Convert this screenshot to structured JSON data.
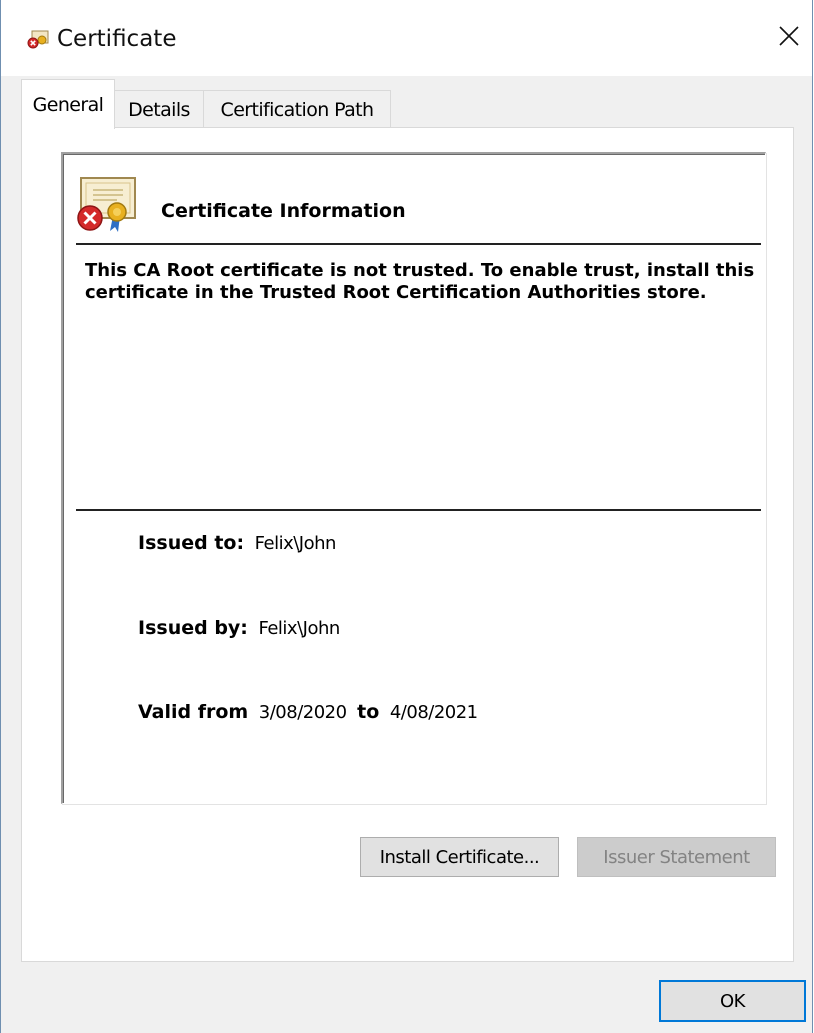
{
  "window": {
    "title": "Certificate",
    "title_icon": "certificate-error-icon",
    "close_icon": "close-icon"
  },
  "tabs": [
    {
      "label": "General",
      "active": true
    },
    {
      "label": "Details",
      "active": false
    },
    {
      "label": "Certification Path",
      "active": false
    }
  ],
  "general": {
    "icon": "certificate-error-icon",
    "heading": "Certificate Information",
    "message": "This CA Root certificate is not trusted. To enable trust, install this certificate in the Trusted Root Certification Authorities store.",
    "issued_to_label": "Issued to:",
    "issued_to_value": "Felix\\John",
    "issued_by_label": "Issued by:",
    "issued_by_value": "Felix\\John",
    "valid_from_label": "Valid from",
    "valid_from_value": "3/08/2020",
    "valid_to_label": "to",
    "valid_to_value": "4/08/2021"
  },
  "buttons": {
    "install": "Install Certificate...",
    "issuer_statement": "Issuer Statement",
    "ok": "OK"
  },
  "colors": {
    "focus_border": "#0078d7",
    "disabled_text": "#838383",
    "error_red": "#d42a2a",
    "seal_gold": "#e8b020"
  }
}
